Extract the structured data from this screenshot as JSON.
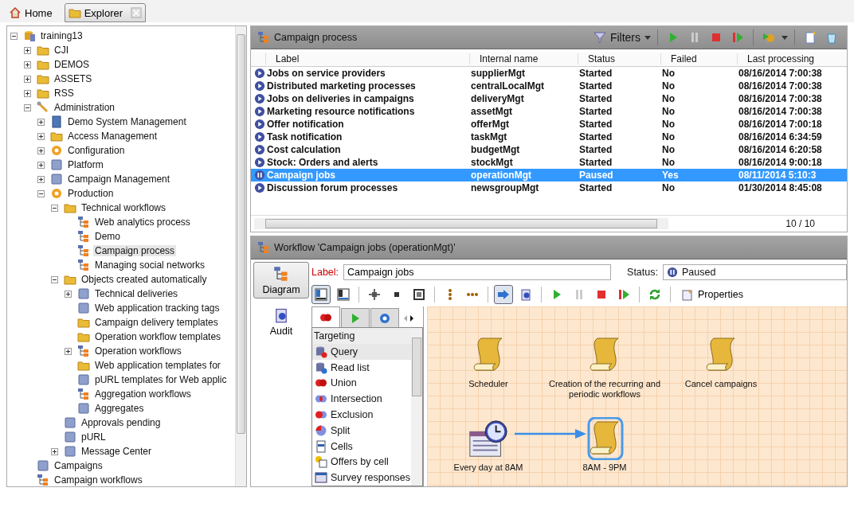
{
  "tabs": [
    {
      "label": "Home",
      "kind": "home",
      "selected": false,
      "closable": false
    },
    {
      "label": "Explorer",
      "kind": "explorer",
      "selected": true,
      "closable": true
    }
  ],
  "tree": [
    {
      "label": "training13",
      "kind": "root",
      "expanded": true,
      "selected": false,
      "children": [
        {
          "label": "CJI",
          "kind": "folder",
          "expanded": false,
          "selected": false
        },
        {
          "label": "DEMOS",
          "kind": "folder",
          "expanded": false,
          "selected": false
        },
        {
          "label": "ASSETS",
          "kind": "folder",
          "expanded": false,
          "selected": false
        },
        {
          "label": "RSS",
          "kind": "folder",
          "expanded": false,
          "selected": false
        },
        {
          "label": "Administration",
          "kind": "tool",
          "expanded": true,
          "selected": false,
          "children": [
            {
              "label": "Demo System Management",
              "kind": "book",
              "expanded": false,
              "selected": false
            },
            {
              "label": "Access Management",
              "kind": "folder",
              "expanded": false,
              "selected": false
            },
            {
              "label": "Configuration",
              "kind": "gear",
              "expanded": false,
              "selected": false
            },
            {
              "label": "Platform",
              "kind": "generic",
              "expanded": false,
              "selected": false
            },
            {
              "label": "Campaign Management",
              "kind": "generic",
              "expanded": false,
              "selected": false
            },
            {
              "label": "Production",
              "kind": "gear",
              "expanded": true,
              "selected": false,
              "children": [
                {
                  "label": "Technical workflows",
                  "kind": "folder",
                  "expanded": true,
                  "selected": false,
                  "children": [
                    {
                      "label": "Web analytics process",
                      "kind": "workflow",
                      "selected": false
                    },
                    {
                      "label": "Demo",
                      "kind": "workflow",
                      "selected": false
                    },
                    {
                      "label": "Campaign process",
                      "kind": "workflow",
                      "selected": true
                    },
                    {
                      "label": "Managing social networks",
                      "kind": "workflow",
                      "selected": false
                    }
                  ]
                },
                {
                  "label": "Objects created automatically",
                  "kind": "folder",
                  "expanded": true,
                  "selected": false,
                  "children": [
                    {
                      "label": "Technical deliveries",
                      "kind": "generic",
                      "expanded": false,
                      "selected": false
                    },
                    {
                      "label": "Web application tracking tags",
                      "kind": "generic",
                      "selected": false
                    },
                    {
                      "label": "Campaign delivery templates",
                      "kind": "folder",
                      "selected": false
                    },
                    {
                      "label": "Operation workflow templates",
                      "kind": "folder",
                      "selected": false
                    },
                    {
                      "label": "Operation workflows",
                      "kind": "workflow",
                      "expanded": false,
                      "selected": false
                    },
                    {
                      "label": "Web application templates for",
                      "kind": "folder",
                      "selected": false
                    },
                    {
                      "label": "pURL templates for Web applic",
                      "kind": "generic",
                      "selected": false
                    },
                    {
                      "label": "Aggregation workflows",
                      "kind": "workflow",
                      "selected": false
                    },
                    {
                      "label": "Aggregates",
                      "kind": "generic",
                      "selected": false
                    }
                  ]
                },
                {
                  "label": "Approvals pending",
                  "kind": "generic",
                  "selected": false
                },
                {
                  "label": "pURL",
                  "kind": "generic",
                  "selected": false
                },
                {
                  "label": "Message Center",
                  "kind": "generic",
                  "expanded": false,
                  "selected": false
                }
              ]
            }
          ]
        },
        {
          "label": "Campaigns",
          "kind": "generic",
          "selected": false
        },
        {
          "label": "Campaign workflows",
          "kind": "workflow",
          "selected": false
        }
      ]
    }
  ],
  "process_list": {
    "title": "Campaign process",
    "filters": "Filters",
    "columns": [
      "Label",
      "Internal name",
      "Status",
      "Failed",
      "Last processing"
    ],
    "rows": [
      {
        "kind": "started",
        "selected": false,
        "cells": [
          "Jobs on service providers",
          "supplierMgt",
          "Started",
          "No",
          "08/16/2014 7:00:38"
        ]
      },
      {
        "kind": "started",
        "selected": false,
        "cells": [
          "Distributed marketing processes",
          "centralLocalMgt",
          "Started",
          "No",
          "08/16/2014 7:00:38"
        ]
      },
      {
        "kind": "started",
        "selected": false,
        "cells": [
          "Jobs on deliveries in campaigns",
          "deliveryMgt",
          "Started",
          "No",
          "08/16/2014 7:00:38"
        ]
      },
      {
        "kind": "started",
        "selected": false,
        "cells": [
          "Marketing resource notifications",
          "assetMgt",
          "Started",
          "No",
          "08/16/2014 7:00:38"
        ]
      },
      {
        "kind": "started",
        "selected": false,
        "cells": [
          "Offer notification",
          "offerMgt",
          "Started",
          "No",
          "08/16/2014 7:00:18"
        ]
      },
      {
        "kind": "started",
        "selected": false,
        "cells": [
          "Task notification",
          "taskMgt",
          "Started",
          "No",
          "08/16/2014 6:34:59"
        ]
      },
      {
        "kind": "started",
        "selected": false,
        "cells": [
          "Cost calculation",
          "budgetMgt",
          "Started",
          "No",
          "08/16/2014 6:20:58"
        ]
      },
      {
        "kind": "started",
        "selected": false,
        "cells": [
          "Stock: Orders and alerts",
          "stockMgt",
          "Started",
          "No",
          "08/16/2014 9:00:18"
        ]
      },
      {
        "kind": "paused",
        "selected": true,
        "cells": [
          "Campaign jobs",
          "operationMgt",
          "Paused",
          "Yes",
          "08/11/2014 5:10:3"
        ]
      },
      {
        "kind": "started",
        "selected": false,
        "cells": [
          "Discussion forum processes",
          "newsgroupMgt",
          "Started",
          "No",
          "01/30/2014 8:45:08"
        ]
      }
    ],
    "count": "10 / 10"
  },
  "workflow": {
    "title": "Workflow 'Campaign jobs (operationMgt)'",
    "views": [
      {
        "label": "Diagram",
        "kind": "diagram",
        "selected": true
      },
      {
        "label": "Audit",
        "kind": "audit",
        "selected": false
      }
    ],
    "label_caption": "Label:",
    "label_value": "Campaign jobs",
    "status_caption": "Status:",
    "status_value": "Paused",
    "toolbar": [
      {
        "kind": "view-left",
        "pressed": true
      },
      {
        "kind": "view-bottom",
        "pressed": false
      },
      {
        "kind": "move",
        "pressed": false
      },
      {
        "kind": "square",
        "pressed": false
      },
      {
        "kind": "fit",
        "pressed": false
      },
      {
        "kind": "chain-v",
        "pressed": false
      },
      {
        "kind": "chain-h",
        "pressed": false
      },
      {
        "kind": "run-arrow",
        "pressed": true
      },
      {
        "kind": "info-doc",
        "pressed": false
      },
      {
        "kind": "play",
        "pressed": false
      },
      {
        "kind": "pause",
        "pressed": false
      },
      {
        "kind": "stop",
        "pressed": false
      },
      {
        "kind": "resume",
        "pressed": false
      },
      {
        "kind": "refresh",
        "pressed": false
      }
    ],
    "properties": "Properties",
    "palette": {
      "tabs": [
        {
          "kind": "targeting",
          "selected": true
        },
        {
          "kind": "play",
          "selected": false
        },
        {
          "kind": "action",
          "selected": false
        }
      ],
      "heading": "Targeting",
      "items": [
        {
          "label": "Query",
          "kind": "query",
          "selected": true
        },
        {
          "label": "Read list",
          "kind": "readlist",
          "selected": false
        },
        {
          "label": "Union",
          "kind": "targeting",
          "selected": false
        },
        {
          "label": "Intersection",
          "kind": "intersection",
          "selected": false
        },
        {
          "label": "Exclusion",
          "kind": "exclusion",
          "selected": false
        },
        {
          "label": "Split",
          "kind": "split",
          "selected": false
        },
        {
          "label": "Cells",
          "kind": "cells",
          "selected": false
        },
        {
          "label": "Offers by cell",
          "kind": "offers",
          "selected": false
        },
        {
          "label": "Survey responses",
          "kind": "survey",
          "selected": false
        }
      ]
    },
    "nodes": [
      {
        "label": "Scheduler",
        "kind": "scroll",
        "selected": false
      },
      {
        "label": "Creation of the recurring and periodic workflows",
        "kind": "scroll",
        "selected": false
      },
      {
        "label": "Cancel campaigns",
        "kind": "scroll",
        "selected": false
      },
      {
        "label": "Every day at 8AM",
        "kind": "scheduler",
        "selected": false
      },
      {
        "label": "8AM - 9PM",
        "kind": "scroll",
        "selected": true
      }
    ]
  }
}
